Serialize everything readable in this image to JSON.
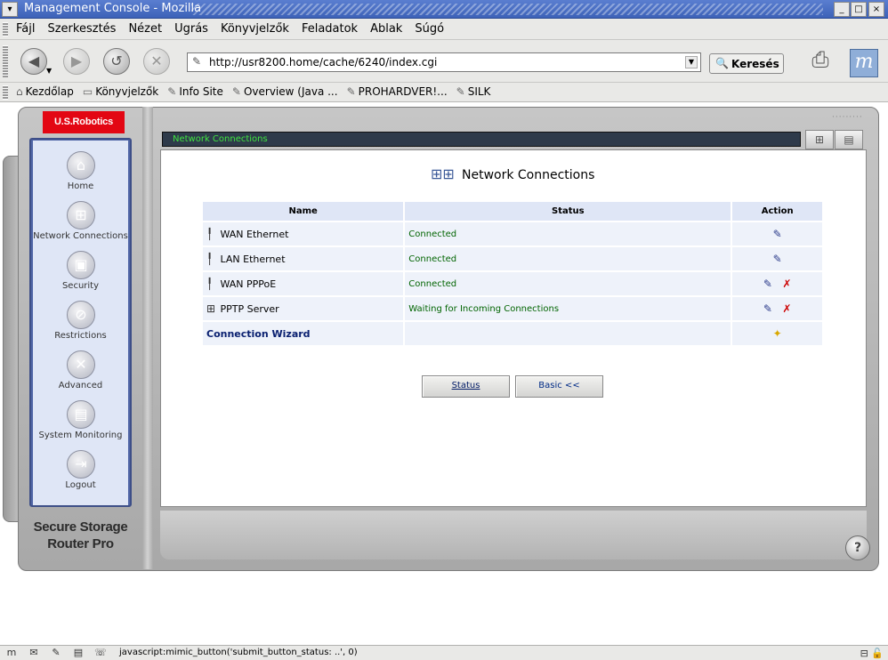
{
  "window": {
    "title": "Management Console - Mozilla",
    "controls": [
      "_",
      "□",
      "×"
    ]
  },
  "menubar": [
    "Fájl",
    "Szerkesztés",
    "Nézet",
    "Ugrás",
    "Könyvjelzők",
    "Feladatok",
    "Ablak",
    "Súgó"
  ],
  "navbar": {
    "url": "http://usr8200.home/cache/6240/index.cgi",
    "search_label": "Keresés"
  },
  "bookmarks": [
    {
      "label": "Kezdőlap",
      "icon": "home-icon"
    },
    {
      "label": "Könyvjelzők",
      "icon": "folder-icon"
    },
    {
      "label": "Info Site",
      "icon": "bookmark-icon"
    },
    {
      "label": "Overview (Java ...",
      "icon": "bookmark-icon"
    },
    {
      "label": "PROHARDVER!...",
      "icon": "bookmark-icon"
    },
    {
      "label": "SILK",
      "icon": "bookmark-icon"
    }
  ],
  "router": {
    "brand": "U.S.Robotics",
    "product": [
      "Secure Storage",
      "Router Pro"
    ],
    "header_title": "Network Connections",
    "nav": [
      {
        "label": "Home",
        "icon": "house-icon"
      },
      {
        "label": "Network Connections",
        "icon": "network-icon"
      },
      {
        "label": "Security",
        "icon": "lock-icon"
      },
      {
        "label": "Restrictions",
        "icon": "restriction-icon"
      },
      {
        "label": "Advanced",
        "icon": "tools-icon"
      },
      {
        "label": "System Monitoring",
        "icon": "monitor-icon"
      },
      {
        "label": "Logout",
        "icon": "logout-icon"
      }
    ]
  },
  "page": {
    "title": "Network Connections",
    "table": {
      "headers": [
        "Name",
        "Status",
        "Action"
      ],
      "rows": [
        {
          "name": "WAN Ethernet",
          "status": "Connected",
          "actions": [
            "edit"
          ]
        },
        {
          "name": "LAN Ethernet",
          "status": "Connected",
          "actions": [
            "edit"
          ]
        },
        {
          "name": "WAN PPPoE",
          "status": "Connected",
          "actions": [
            "edit",
            "delete"
          ]
        },
        {
          "name": "PPTP Server",
          "status": "Waiting for Incoming Connections",
          "actions": [
            "edit",
            "delete"
          ]
        }
      ],
      "wizard": "Connection Wizard"
    },
    "buttons": {
      "status": "Status",
      "basic": "Basic <<"
    }
  },
  "statusbar": {
    "text": "javascript:mimic_button('submit_button_status: ..', 0)"
  }
}
